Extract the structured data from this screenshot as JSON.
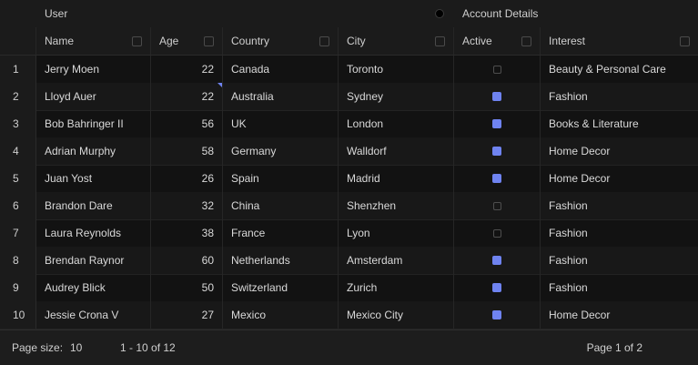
{
  "groups": {
    "user": "User",
    "account": "Account Details"
  },
  "columns": {
    "name": "Name",
    "age": "Age",
    "country": "Country",
    "city": "City",
    "active": "Active",
    "interest": "Interest"
  },
  "rows": [
    {
      "num": "1",
      "name": "Jerry Moen",
      "age": "22",
      "country": "Canada",
      "city": "Toronto",
      "active": false,
      "interest": "Beauty & Personal Care"
    },
    {
      "num": "2",
      "name": "Lloyd Auer",
      "age": "22",
      "country": "Australia",
      "city": "Sydney",
      "active": true,
      "interest": "Fashion"
    },
    {
      "num": "3",
      "name": "Bob Bahringer II",
      "age": "56",
      "country": "UK",
      "city": "London",
      "active": true,
      "interest": "Books & Literature"
    },
    {
      "num": "4",
      "name": "Adrian Murphy",
      "age": "58",
      "country": "Germany",
      "city": "Walldorf",
      "active": true,
      "interest": "Home Decor"
    },
    {
      "num": "5",
      "name": "Juan Yost",
      "age": "26",
      "country": "Spain",
      "city": "Madrid",
      "active": true,
      "interest": "Home Decor"
    },
    {
      "num": "6",
      "name": "Brandon Dare",
      "age": "32",
      "country": "China",
      "city": "Shenzhen",
      "active": false,
      "interest": "Fashion"
    },
    {
      "num": "7",
      "name": "Laura Reynolds",
      "age": "38",
      "country": "France",
      "city": "Lyon",
      "active": false,
      "interest": "Fashion"
    },
    {
      "num": "8",
      "name": "Brendan Raynor",
      "age": "60",
      "country": "Netherlands",
      "city": "Amsterdam",
      "active": true,
      "interest": "Fashion"
    },
    {
      "num": "9",
      "name": "Audrey Blick",
      "age": "50",
      "country": "Switzerland",
      "city": "Zurich",
      "active": true,
      "interest": "Fashion"
    },
    {
      "num": "10",
      "name": "Jessie Crona V",
      "age": "27",
      "country": "Mexico",
      "city": "Mexico City",
      "active": true,
      "interest": "Home Decor"
    }
  ],
  "footer": {
    "page_size_label": "Page size:",
    "page_size_value": "10",
    "range": "1 - 10 of 12",
    "page": "Page 1 of 2"
  },
  "colors": {
    "accent": "#6f83f0",
    "background": "#121212"
  }
}
